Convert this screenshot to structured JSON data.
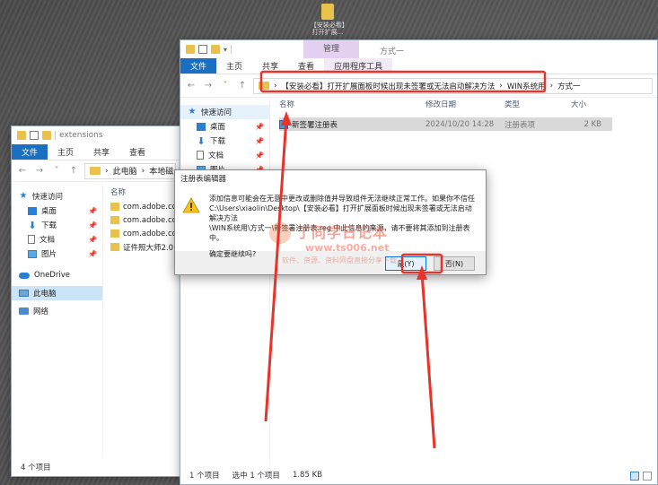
{
  "desktop": {
    "icon_label": "【安装必看】打开扩展..."
  },
  "back_window": {
    "title": "extensions",
    "tabs": [
      "文件",
      "主页",
      "共享",
      "查看"
    ],
    "address": [
      "此电脑",
      "本地磁盘 (C:)"
    ],
    "nav": [
      {
        "label": "快速访问",
        "icon": "star-icon"
      },
      {
        "label": "桌面",
        "icon": "desktop-icon"
      },
      {
        "label": "下载",
        "icon": "download-icon"
      },
      {
        "label": "文档",
        "icon": "document-icon"
      },
      {
        "label": "图片",
        "icon": "pictures-icon"
      },
      {
        "label": "OneDrive",
        "icon": "onedrive-icon"
      },
      {
        "label": "此电脑",
        "icon": "this-pc-icon"
      },
      {
        "label": "网络",
        "icon": "network-icon"
      }
    ],
    "col_name": "名称",
    "files": [
      "com.adobe.ccx.",
      "com.adobe.ccx.",
      "com.adobe.ccx.",
      "证件照大师2.0"
    ],
    "status": "4 个项目"
  },
  "front_window": {
    "context_tab_group": "管理",
    "title": "方式一",
    "tabs": [
      "文件",
      "主页",
      "共享",
      "查看",
      "应用程序工具"
    ],
    "address": [
      "【安装必看】打开扩展面板时候出现未签署或无法启动解决方法",
      "WIN系统用",
      "方式一"
    ],
    "nav": [
      {
        "label": "快速访问",
        "icon": "star-icon"
      },
      {
        "label": "桌面",
        "icon": "desktop-icon"
      },
      {
        "label": "下载",
        "icon": "download-icon"
      },
      {
        "label": "文档",
        "icon": "document-icon"
      },
      {
        "label": "图片",
        "icon": "pictures-icon"
      }
    ],
    "columns": {
      "name": "名称",
      "modified": "修改日期",
      "type": "类型",
      "size": "大小"
    },
    "files": [
      {
        "name": "新签署注册表",
        "modified": "2024/10/20 14:28",
        "type": "注册表项",
        "size": "2 KB"
      }
    ],
    "status": {
      "count": "1 个项目",
      "selected": "选中 1 个项目",
      "size": "1.85 KB"
    }
  },
  "dialog": {
    "title": "注册表编辑器",
    "message_l1": "添加信息可能会在无意中更改或删除值并导致组件无法继续正常工作。如果你不信任",
    "message_l2": "C:\\Users\\xiaolin\\Desktop\\【安装必看】打开扩展面板时候出现未签署或无法启动解决方法",
    "message_l3": "\\WIN系统用\\方式一\\新签署注册表.reg 中此信息的来源，请不要将其添加到注册表中。",
    "question": "确定要继续吗?",
    "yes": "是(Y)",
    "no": "否(N)"
  },
  "watermark": {
    "line1": "丁同学日记本",
    "line2": "www.ts006.net",
    "line3": "软件、资源、资料网盘直接分享下载"
  },
  "colors": {
    "accent": "#1a6fc0",
    "annotation": "#e8332a",
    "context_tab": "#e4d0f0"
  }
}
